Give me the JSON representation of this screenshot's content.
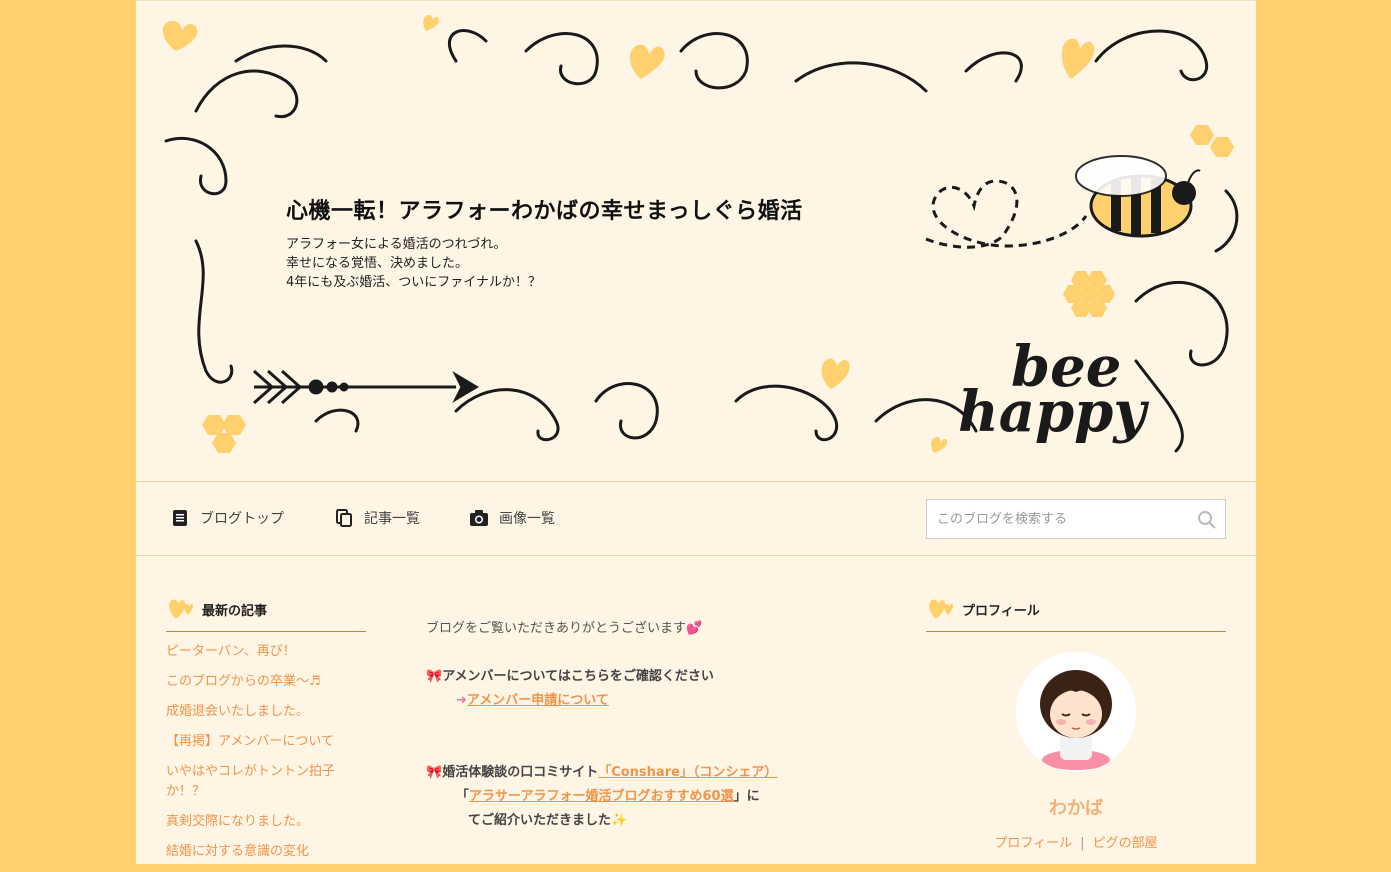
{
  "header": {
    "title": "心機一転！アラフォーわかばの幸せまっしぐら婚活",
    "description": [
      "アラフォー女による婚活のつれづれ。",
      "幸せになる覚悟、決めました。",
      "4年にも及ぶ婚活、ついにファイナルか！？"
    ],
    "logo_text_1": "bee",
    "logo_text_2": "happy"
  },
  "nav": {
    "items": [
      {
        "label": "ブログトップ",
        "icon": "document-icon"
      },
      {
        "label": "記事一覧",
        "icon": "copy-icon"
      },
      {
        "label": "画像一覧",
        "icon": "camera-icon"
      }
    ],
    "search_placeholder": "このブログを検索する"
  },
  "recent": {
    "heading": "最新の記事",
    "items": [
      "ピーターパン、再び！",
      "このブログからの卒業〜♬",
      "成婚退会いたしました。",
      "【再掲】アメンバーについて",
      "いやはやコレがトントン拍子か！？",
      "真剣交際になりました。",
      "結婚に対する意識の変化"
    ]
  },
  "main": {
    "greeting": "ブログをご覧いただきありがとうございます",
    "amember_text": "アメンバーについてはこちらをご確認ください",
    "amember_link": "アメンバー申請について",
    "review_text": "婚活体験談の口コミサイト",
    "review_link": "「Conshare」（コンシェア）",
    "open_bracket": "「",
    "blog_link": "アラサーアラフォー婚活ブログおすすめ60選",
    "close_bracket": "」に",
    "intro_text": "てご紹介いただきました"
  },
  "profile": {
    "heading": "プロフィール",
    "name": "わかば",
    "link_profile": "プロフィール",
    "separator": "|",
    "link_room": "ピグの部屋"
  },
  "colors": {
    "page_bg": "#ffd16e",
    "content_bg": "#fff5e4",
    "accent": "#f0944a",
    "heart": "#ffd16e"
  }
}
